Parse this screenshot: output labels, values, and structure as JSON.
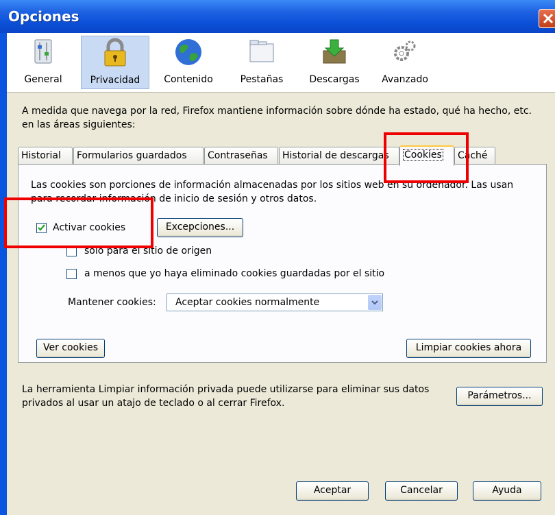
{
  "window": {
    "title": "Opciones"
  },
  "toolbar": {
    "items": [
      {
        "label": "General",
        "icon": "general-sliders-icon"
      },
      {
        "label": "Privacidad",
        "icon": "padlock-icon"
      },
      {
        "label": "Contenido",
        "icon": "globe-icon"
      },
      {
        "label": "Pestañas",
        "icon": "tabs-window-icon"
      },
      {
        "label": "Descargas",
        "icon": "download-box-icon"
      },
      {
        "label": "Avanzado",
        "icon": "gears-icon"
      }
    ],
    "selected": "Privacidad"
  },
  "description": "A medida que navega por la red, Firefox mantiene información sobre dónde ha estado, qué ha hecho, etc. en las áreas siguientes:",
  "tabs": [
    "Historial",
    "Formularios guardados",
    "Contraseñas",
    "Historial de descargas",
    "Cookies",
    "Caché"
  ],
  "active_tab": "Cookies",
  "cookies": {
    "intro": "Las cookies son porciones de información almacenadas por los sitios web en su ordenador. Las usan para recordar información de inicio de sesión y otros datos.",
    "activar_label": "Activar cookies",
    "activar_checked": true,
    "excepciones_label": "Excepciones...",
    "solo_origen_label": "sólo para el sitio de origen",
    "solo_origen_checked": false,
    "a_menos_label": "a menos que yo haya eliminado cookies guardadas por el sitio",
    "a_menos_checked": false,
    "mantener_label": "Mantener cookies:",
    "mantener_value": "Aceptar cookies normalmente",
    "ver_cookies_label": "Ver cookies",
    "limpiar_label": "Limpiar cookies ahora"
  },
  "private_data": {
    "text": "La herramienta Limpiar información privada puede utilizarse para eliminar sus datos privados al usar un atajo de teclado o al cerrar Firefox.",
    "parametros_label": "Parámetros..."
  },
  "footer": {
    "aceptar": "Aceptar",
    "cancelar": "Cancelar",
    "ayuda": "Ayuda"
  },
  "colors": {
    "titlebar": "#0A55E0",
    "highlight": "#EE0000",
    "dialog": "#ECE9D8"
  }
}
